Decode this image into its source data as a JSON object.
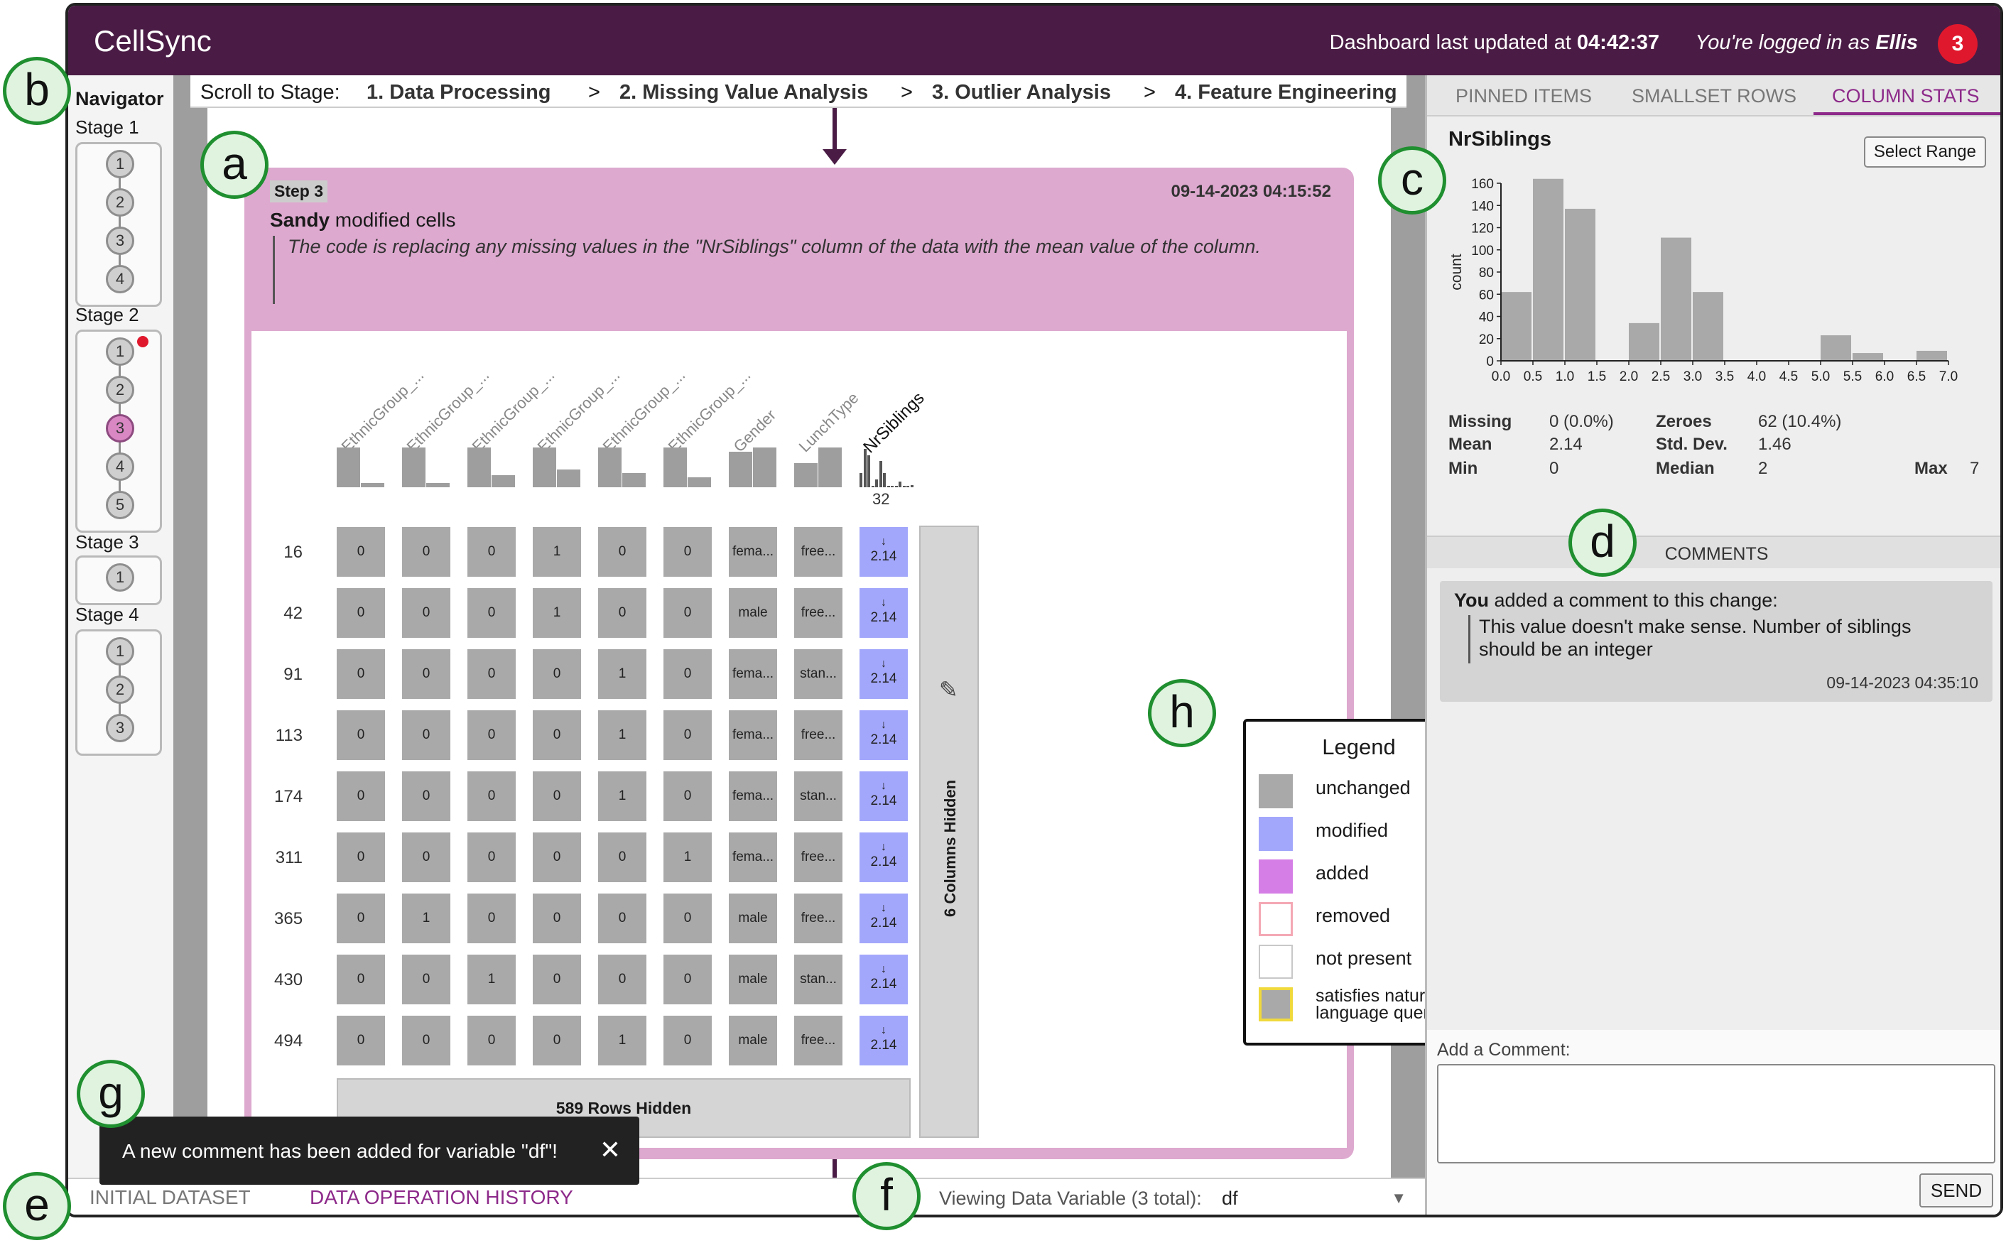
{
  "header": {
    "app_title": "CellSync",
    "updated_prefix": "Dashboard last updated at ",
    "updated_time": "04:42:37",
    "login_prefix": "You're logged in as ",
    "login_user": "Ellis",
    "notification_count": "3"
  },
  "navigator": {
    "title": "Navigator",
    "stages": [
      {
        "label": "Stage 1",
        "steps": [
          "1",
          "2",
          "3",
          "4"
        ]
      },
      {
        "label": "Stage 2",
        "steps": [
          "1",
          "2",
          "3",
          "4",
          "5"
        ]
      },
      {
        "label": "Stage 3",
        "steps": [
          "1"
        ]
      },
      {
        "label": "Stage 4",
        "steps": [
          "1",
          "2",
          "3"
        ]
      }
    ]
  },
  "stage_bar": {
    "prefix": "Scroll to Stage:",
    "stages": [
      "1. Data Processing",
      "2. Missing Value Analysis",
      "3. Outlier Analysis",
      "4. Feature Engineering"
    ],
    "separator": ">"
  },
  "step_card": {
    "tag": "Step 3",
    "timestamp": "09-14-2023 04:15:52",
    "author": "Sandy",
    "action": " modified cells",
    "description": "The code is replacing any missing values in the \"NrSiblings\" column of the data with the mean value of the column."
  },
  "table": {
    "columns": [
      "EthnicGroup_...",
      "EthnicGroup_...",
      "EthnicGroup_...",
      "EthnicGroup_...",
      "EthnicGroup_...",
      "EthnicGroup_...",
      "Gender",
      "LunchType",
      "NrSiblings"
    ],
    "count_label": "32",
    "rows": [
      {
        "idx": "16",
        "cells": [
          "0",
          "0",
          "0",
          "1",
          "0",
          "0",
          "fema...",
          "free...",
          "2.14"
        ]
      },
      {
        "idx": "42",
        "cells": [
          "0",
          "0",
          "0",
          "1",
          "0",
          "0",
          "male",
          "free...",
          "2.14"
        ]
      },
      {
        "idx": "91",
        "cells": [
          "0",
          "0",
          "0",
          "0",
          "1",
          "0",
          "fema...",
          "stan...",
          "2.14"
        ]
      },
      {
        "idx": "113",
        "cells": [
          "0",
          "0",
          "0",
          "0",
          "1",
          "0",
          "fema...",
          "free...",
          "2.14"
        ]
      },
      {
        "idx": "174",
        "cells": [
          "0",
          "0",
          "0",
          "0",
          "1",
          "0",
          "fema...",
          "stan...",
          "2.14"
        ]
      },
      {
        "idx": "311",
        "cells": [
          "0",
          "0",
          "0",
          "0",
          "0",
          "1",
          "fema...",
          "free...",
          "2.14"
        ]
      },
      {
        "idx": "365",
        "cells": [
          "0",
          "1",
          "0",
          "0",
          "0",
          "0",
          "male",
          "free...",
          "2.14"
        ]
      },
      {
        "idx": "430",
        "cells": [
          "0",
          "0",
          "1",
          "0",
          "0",
          "0",
          "male",
          "stan...",
          "2.14"
        ]
      },
      {
        "idx": "494",
        "cells": [
          "0",
          "0",
          "0",
          "0",
          "1",
          "0",
          "male",
          "free...",
          "2.14"
        ]
      }
    ],
    "hidden_columns": "6 Columns Hidden",
    "hidden_rows": "589 Rows Hidden",
    "modified_marker": "↓"
  },
  "legend": {
    "title": "Legend",
    "items": [
      {
        "label": "unchanged",
        "color": "#a9a9a9"
      },
      {
        "label": "modified",
        "color": "#a3a7fb"
      },
      {
        "label": "added",
        "color": "#d57ee6"
      },
      {
        "label": "removed",
        "color": "#f4a8b4"
      },
      {
        "label": "not present",
        "color": "#c8c8c8"
      },
      {
        "label": "satisfies natural language query",
        "color": "#f0d93c"
      }
    ]
  },
  "controls": {
    "info": "ⓘ",
    "zoom_in": "+",
    "zoom_out": "-"
  },
  "toast": {
    "text": "A new comment has been added for variable \"df\"!",
    "close": "✕"
  },
  "bottom_bar": {
    "tabs": [
      "INITIAL DATASET",
      "DATA OPERATION HISTORY"
    ],
    "active_tab": "DATA OPERATION HISTORY",
    "var_label": "Viewing Data Variable (3 total):",
    "var_value": "df"
  },
  "right_panel": {
    "tabs": [
      "PINNED ITEMS",
      "SMALLSET ROWS",
      "COLUMN STATS"
    ],
    "active_tab": "COLUMN STATS",
    "column_name": "NrSiblings",
    "select_range": "Select Range",
    "stats": {
      "missing_label": "Missing",
      "missing_value": "0 (0.0%)",
      "zeroes_label": "Zeroes",
      "zeroes_value": "62 (10.4%)",
      "mean_label": "Mean",
      "mean_value": "2.14",
      "std_label": "Std. Dev.",
      "std_value": "1.46",
      "min_label": "Min",
      "min_value": "0",
      "median_label": "Median",
      "median_value": "2",
      "max_label": "Max",
      "max_value": "7"
    },
    "comments_title": "COMMENTS",
    "comment": {
      "author": "You",
      "action": " added a comment to this change:",
      "text": "This value doesn't make sense. Number of siblings should be an integer",
      "timestamp": "09-14-2023 04:35:10"
    },
    "add_comment_label": "Add a Comment:",
    "send_label": "SEND"
  },
  "chart_data": {
    "type": "bar",
    "title": "",
    "xlabel": "",
    "ylabel": "count",
    "bins": [
      [
        0,
        0.5
      ],
      [
        0.5,
        1.0
      ],
      [
        1.0,
        1.5
      ],
      [
        1.5,
        2.0
      ],
      [
        2.0,
        2.5
      ],
      [
        2.5,
        3.0
      ],
      [
        3.0,
        3.5
      ],
      [
        3.5,
        4.0
      ],
      [
        4.0,
        4.5
      ],
      [
        4.5,
        5.0
      ],
      [
        5.0,
        5.5
      ],
      [
        5.5,
        6.0
      ],
      [
        6.0,
        6.5
      ],
      [
        6.5,
        7.0
      ]
    ],
    "values": [
      62,
      164,
      137,
      0,
      34,
      111,
      62,
      0,
      0,
      0,
      23,
      7,
      0,
      9
    ],
    "xticks": [
      "0.0",
      "0.5",
      "1.0",
      "1.5",
      "2.0",
      "2.5",
      "3.0",
      "3.5",
      "4.0",
      "4.5",
      "5.0",
      "5.5",
      "6.0",
      "6.5",
      "7.0"
    ],
    "yticks": [
      "0",
      "20",
      "40",
      "60",
      "80",
      "100",
      "120",
      "140",
      "160"
    ],
    "xlim": [
      0,
      7
    ],
    "ylim": [
      0,
      160
    ],
    "bar_color": "#a9a9a9"
  },
  "annotations": [
    "a",
    "b",
    "c",
    "d",
    "e",
    "f",
    "g",
    "h"
  ],
  "colors": {
    "brand": "#4a1c45",
    "accent": "#8d2a8a",
    "notification": "#e0182d",
    "modified": "#a3a7fb",
    "card": "#dda9cf"
  }
}
